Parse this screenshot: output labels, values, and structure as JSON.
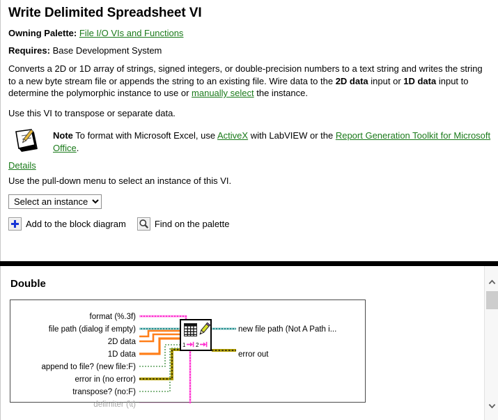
{
  "page": {
    "title": "Write Delimited Spreadsheet VI"
  },
  "meta": {
    "owning_palette_label": "Owning Palette:",
    "owning_palette_link": "File I/O VIs and Functions",
    "requires_label": "Requires:",
    "requires_value": "Base Development System"
  },
  "description": {
    "part1": "Converts a 2D or 1D array of strings, signed integers, or double-precision numbers to a text string and writes the string to a new byte stream file or appends the string to an existing file. Wire data to the ",
    "bold1": "2D data",
    "part2": " input or ",
    "bold2": "1D data",
    "part3": " input to determine the polymorphic instance to use or ",
    "link1": "manually select",
    "part4": " the instance.",
    "paragraph2": "Use this VI to transpose or separate data."
  },
  "note": {
    "icon": "notepad-pencil-icon",
    "label": "Note",
    "part1": " To format with Microsoft Excel, use ",
    "link1": "ActiveX",
    "part2": " with LabVIEW or the ",
    "link2": "Report Generation Toolkit for Microsoft Office",
    "part3": "."
  },
  "details_link": "Details",
  "pulldown": {
    "instruction": "Use the pull-down menu to select an instance of this VI.",
    "selected": "Select an instance",
    "options": [
      "Select an instance"
    ]
  },
  "actions": [
    {
      "icon": "plus-icon",
      "label": "Add to the block diagram"
    },
    {
      "icon": "search-icon",
      "label": "Find on the palette"
    }
  ],
  "instance": {
    "heading": "Double",
    "inputs": [
      {
        "name": "format (%.3f)",
        "wire": "string",
        "color": "#ff2fcf",
        "dim": false
      },
      {
        "name": "file path (dialog if empty)",
        "wire": "path",
        "color": "#1f8d8d",
        "dim": false
      },
      {
        "name": "2D data",
        "wire": "numeric-array",
        "color": "#ff7f1a",
        "dim": false
      },
      {
        "name": "1D data",
        "wire": "numeric-array",
        "color": "#ff7f1a",
        "dim": false
      },
      {
        "name": "append to file? (new file:F)",
        "wire": "boolean",
        "color": "#5fa05f",
        "dim": false
      },
      {
        "name": "error in (no error)",
        "wire": "error-cluster",
        "color": "#b3a000",
        "dim": false
      },
      {
        "name": "transpose? (no:F)",
        "wire": "boolean",
        "color": "#5fa05f",
        "dim": false
      },
      {
        "name": "delimiter (\\t)",
        "wire": "string",
        "color": "#ff2fcf",
        "dim": true
      }
    ],
    "outputs": [
      {
        "name": "new file path (Not A Path i...",
        "wire": "path",
        "color": "#1f8d8d"
      },
      {
        "name": "error out",
        "wire": "error-cluster",
        "color": "#b3a000"
      }
    ],
    "vi_icon": {
      "name": "write-spreadsheet-vi-icon",
      "terminal_labels": "1 2"
    }
  },
  "scrollbar": {
    "up_glyph": "∧",
    "down_glyph": "∨"
  },
  "colors": {
    "link": "#1a7a1a",
    "accent_blue": "#1836d6",
    "divider": "#000000"
  }
}
